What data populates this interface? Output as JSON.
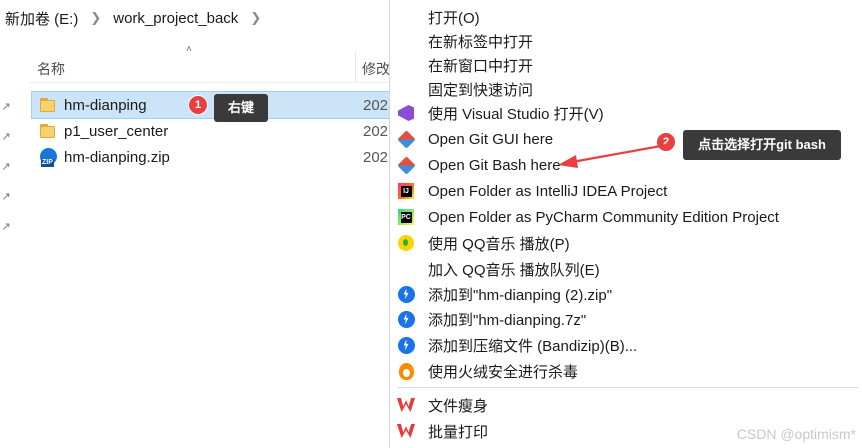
{
  "explorer": {
    "breadcrumb": [
      "新加卷 (E:)",
      "work_project_back"
    ],
    "column_name": "名称",
    "column_date": "修改",
    "files": [
      {
        "name": "hm-dianping",
        "type": "folder",
        "date": "202",
        "selected": true
      },
      {
        "name": "p1_user_center",
        "type": "folder",
        "date": "202",
        "selected": false
      },
      {
        "name": "hm-dianping.zip",
        "type": "zip",
        "date": "202",
        "selected": false
      }
    ]
  },
  "annotations": {
    "step1": {
      "number": "1",
      "text": "右键"
    },
    "step2": {
      "number": "2",
      "text": "点击选择打开git bash"
    },
    "arrow_color": "#e84040"
  },
  "context_menu": {
    "items": [
      {
        "label": "打开(O)",
        "icon": null
      },
      {
        "label": "在新标签中打开",
        "icon": null
      },
      {
        "label": "在新窗口中打开",
        "icon": null
      },
      {
        "label": "固定到快速访问",
        "icon": null
      },
      {
        "label": "使用 Visual Studio 打开(V)",
        "icon": "visual-studio-icon"
      },
      {
        "label": "Open Git GUI here",
        "icon": "git-gui-icon"
      },
      {
        "label": "Open Git Bash here",
        "icon": "git-bash-icon"
      },
      {
        "label": "Open Folder as IntelliJ IDEA Project",
        "icon": "intellij-idea-icon"
      },
      {
        "label": "Open Folder as PyCharm Community Edition Project",
        "icon": "pycharm-icon"
      },
      {
        "label": "使用 QQ音乐 播放(P)",
        "icon": "qq-music-icon"
      },
      {
        "label": "加入 QQ音乐 播放队列(E)",
        "icon": null
      },
      {
        "label": "添加到\"hm-dianping (2).zip\"",
        "icon": "bandizip-icon"
      },
      {
        "label": "添加到\"hm-dianping.7z\"",
        "icon": "bandizip-icon"
      },
      {
        "label": "添加到压缩文件 (Bandizip)(B)...",
        "icon": "bandizip-icon"
      },
      {
        "label": "使用火绒安全进行杀毒",
        "icon": "huorong-icon"
      },
      {
        "label": "文件瘦身",
        "icon": "wps-icon"
      },
      {
        "label": "批量打印",
        "icon": "wps-icon"
      }
    ]
  },
  "watermark": "CSDN @optimism*"
}
